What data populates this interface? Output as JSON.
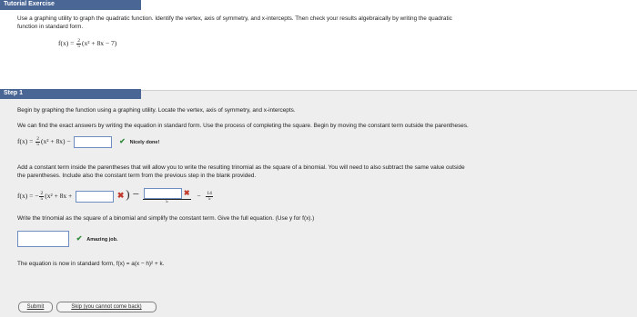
{
  "header": {
    "tab_title": "Tutorial Exercise"
  },
  "instructions": {
    "line1": "Use a graphing utility to graph the quadratic function. Identify the vertex, axis of symmetry, and x-intercepts. Then check your results algebraically by writing the quadratic",
    "line2": "function in standard form.",
    "function": "f(x) = (2/5)(x² + 8x − 7)",
    "fx": "f(x) = ",
    "frac_num": "2",
    "frac_den": "5",
    "rest": "(x² + 8x − 7)"
  },
  "step": {
    "title": "Step 1",
    "intro": "Begin by graphing the function using a graphing utility. Locate the vertex, axis of symmetry, and x-intercepts.",
    "para1": "We can find the exact answers by writing the equation in standard form. Use the process of completing the square. Begin by moving the constant term outside the parentheses.",
    "eq1_fx": "f(x) = ",
    "eq1_num": "2",
    "eq1_den": "5",
    "eq1_rest": "(x² + 8x) −",
    "feedback1": "Nicely done!",
    "para2_line1": "Add a constant term inside the parentheses that will allow you to write the resulting trinomial as the square of a binomial. You will need to also subtract the same value outside",
    "para2_line2": "the parentheses. Include also the constant term from the previous step in the blank provided.",
    "eq2_fx": "f(x) = −",
    "eq2_num": "2",
    "eq2_den": "5",
    "eq2_rest": "(x² + 8x +",
    "eq2_close": ") −",
    "eq2_den2": "5",
    "eq2_minus": "−",
    "eq2_num3": "14",
    "eq2_den3": "5",
    "para3": "Write the trinomial as the square of a binomial and simplify the constant term. Give the full equation. (Use y for f(x).)",
    "feedback2": "Amazing job.",
    "para4": "The equation is now in standard form, f(x) = a(x − h)² + k."
  },
  "buttons": {
    "submit": "Submit",
    "skip": "Skip (you cannot come back)"
  },
  "colors": {
    "accent": "#4a6694",
    "input_border": "#6c8ec2",
    "check": "#2e8b3a",
    "error": "#c0392b"
  }
}
